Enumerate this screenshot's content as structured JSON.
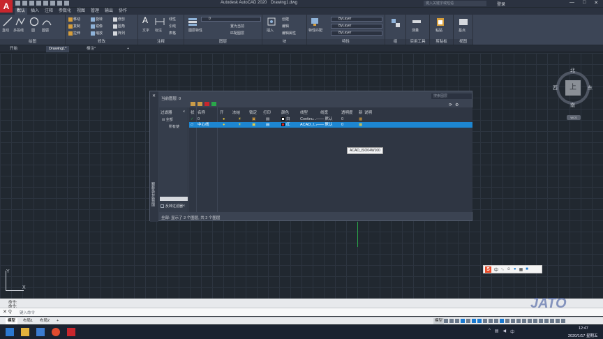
{
  "app": {
    "logo": "A",
    "title": "Autodesk AutoCAD 2020",
    "file": "Drawing1.dwg",
    "search_placeholder": "键入关键字或短语",
    "login": "登录",
    "window_controls": [
      "—",
      "□",
      "✕"
    ]
  },
  "menu_tabs": [
    "默认",
    "插入",
    "注释",
    "参数化",
    "视图",
    "管理",
    "输出",
    "协作"
  ],
  "ribbon": {
    "draw": {
      "label": "绘图",
      "items": [
        "直线",
        "多段线",
        "圆",
        "圆弧"
      ]
    },
    "modify": {
      "label": "修改",
      "items": [
        "移动",
        "旋转",
        "修剪",
        "复制",
        "镜像",
        "圆角",
        "拉伸",
        "缩放",
        "阵列"
      ]
    },
    "annotation": {
      "label": "注释",
      "items": [
        "文字",
        "标注",
        "线性",
        "引线",
        "表格"
      ]
    },
    "layers": {
      "label": "图层",
      "items": [
        "图层特性",
        "置为当前",
        "匹配图层"
      ],
      "current": "0"
    },
    "block": {
      "label": "块",
      "items": [
        "插入",
        "创建",
        "编辑",
        "编辑属性"
      ]
    },
    "properties": {
      "label": "特性",
      "items": [
        "特性匹配"
      ],
      "color": "ByLayer",
      "linetype": "ByLayer",
      "lineweight": "ByLayer"
    },
    "groups": {
      "label": "组"
    },
    "utilities": {
      "label": "实用工具",
      "items": [
        "测量"
      ]
    },
    "clipboard": {
      "label": "剪贴板",
      "items": [
        "粘贴"
      ]
    },
    "view": {
      "label": "视图",
      "items": [
        "基点"
      ]
    }
  },
  "file_tabs": [
    "开始",
    "Drawing1*",
    "楼注*"
  ],
  "viewcube": {
    "face": "上",
    "north": "北",
    "south": "南",
    "east": "东",
    "west": "西",
    "wcs": "WCS"
  },
  "layer_panel": {
    "side_title": "图层特性管理器",
    "current_layer": "当前图层: 0",
    "search_placeholder": "搜索图层",
    "filter_header": "过滤器",
    "filter_all": "全部",
    "filter_used": "所有使",
    "invert_filter": "反转过滤器",
    "collapse": "«",
    "columns": [
      "状",
      "名称",
      "开",
      "冻结",
      "锁定",
      "打印",
      "颜色",
      "线型",
      "线宽",
      "透明度",
      "新",
      "说明"
    ],
    "rows": [
      {
        "status": "✓",
        "name": "0",
        "on": "💡",
        "freeze": "☀",
        "lock": "🔓",
        "plot": "🖨",
        "color": "白",
        "color_hex": "#ffffff",
        "linetype": "Continu...",
        "lineweight": "—— 默认",
        "transparency": "0"
      },
      {
        "status": "▱",
        "name": "中心线",
        "on": "💡",
        "freeze": "☀",
        "lock": "🔓",
        "plot": "🖨",
        "color": "红",
        "color_hex": "#e02020",
        "linetype": "ACAD_I...",
        "lineweight": "—— 默认",
        "transparency": "0"
      }
    ],
    "tooltip": "ACAD_ISO04W100",
    "status": "全部: 显示了 2 个图层, 共 2 个图层"
  },
  "ucs": {
    "x": "X",
    "y": "Y"
  },
  "ime": {
    "logo": "S",
    "lang": "中"
  },
  "command": {
    "history": [
      "命令:",
      "命令:"
    ],
    "placeholder": "键入命令"
  },
  "layout_tabs": [
    "模型",
    "布局1",
    "布局2"
  ],
  "status_model": "模型",
  "watermark": "JATO",
  "taskbar": {
    "time": "12:47",
    "date": "2020/1/17 星期五"
  },
  "colors": {
    "accent": "#1d86d1",
    "brand_red": "#c8262d",
    "ribbon_bg": "#3c4556"
  }
}
